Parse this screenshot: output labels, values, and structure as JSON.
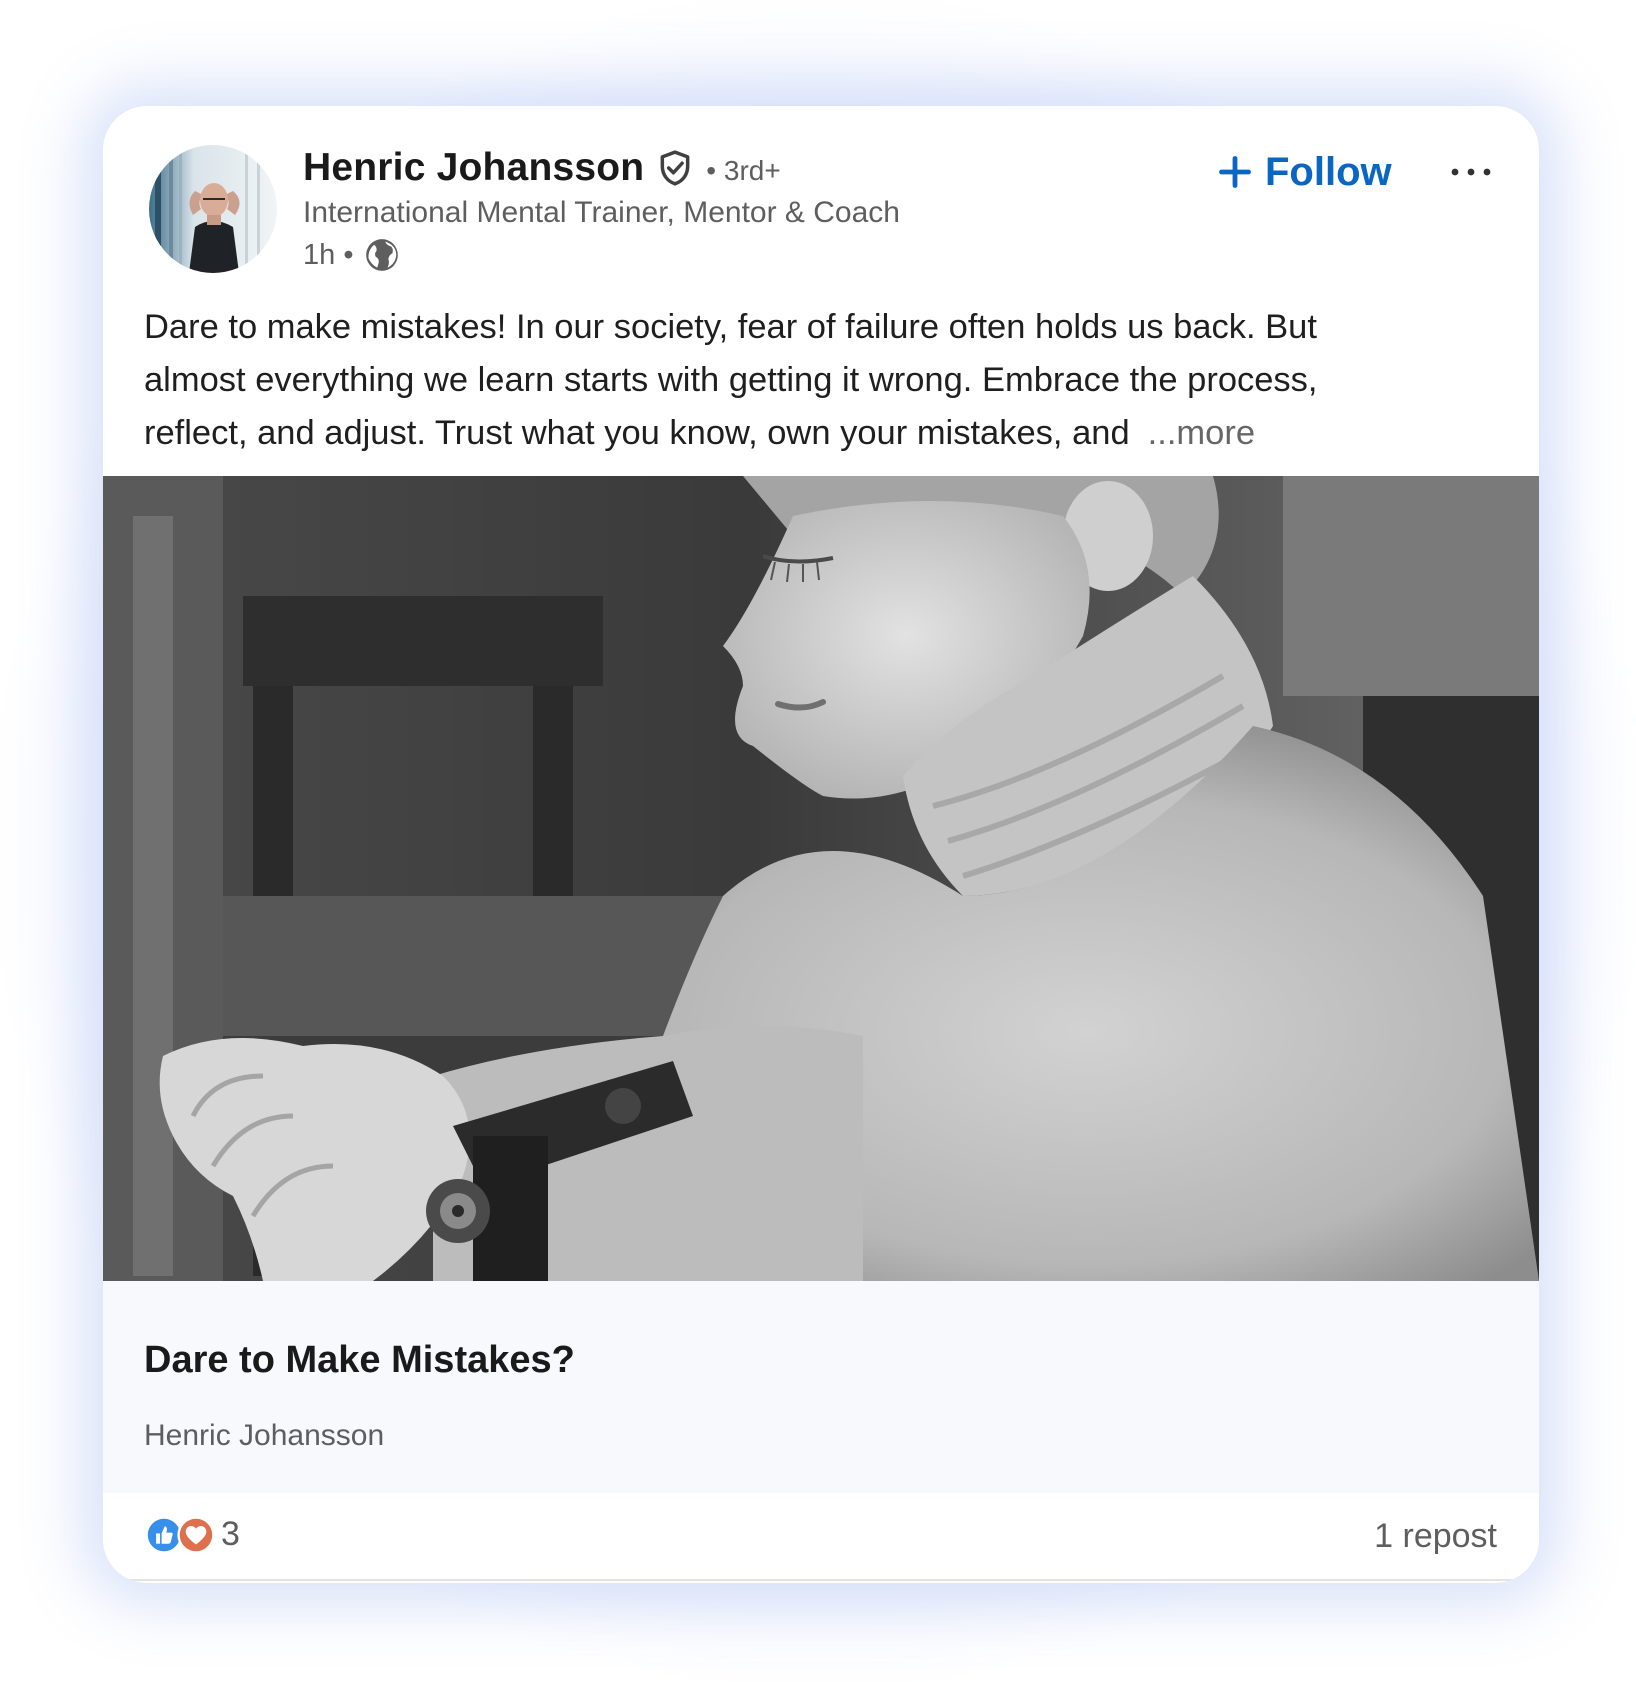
{
  "post": {
    "author": {
      "name": "Henric Johansson",
      "degree": "• 3rd+",
      "headline": "International Mental Trainer, Mentor & Coach",
      "time": "1h •"
    },
    "actions": {
      "follow_label": "Follow"
    },
    "text_lines": [
      "Dare to make mistakes! In our society, fear of failure often holds us back. But",
      "almost everything we learn starts with getting it wrong. Embrace the process,",
      "reflect, and adjust. Trust what you know, own your mistakes, and"
    ],
    "see_more": "...more",
    "article": {
      "title": "Dare to Make Mistakes?",
      "source": "Henric Johansson"
    },
    "social": {
      "reaction_count": "3",
      "reposts": "1 repost"
    }
  },
  "icons": {
    "verified": "shield-check-icon",
    "visibility": "globe-icon",
    "follow": "plus-icon",
    "menu": "ellipsis-icon",
    "reactions": [
      "like-reaction-icon",
      "love-reaction-icon"
    ]
  },
  "colors": {
    "accent": "#0a66c2",
    "like": "#378fe9",
    "love": "#df704d",
    "muted_text": "#5e5e5e",
    "article_bg": "#f7f9fd"
  }
}
